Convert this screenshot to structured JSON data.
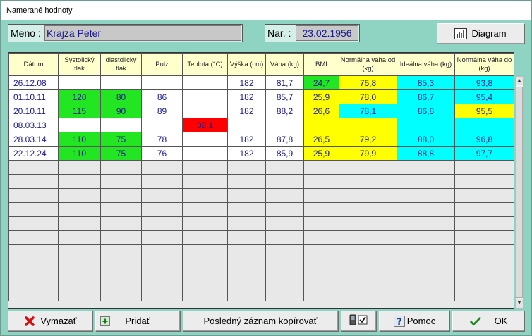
{
  "window": {
    "title": "Namerané hodnoty"
  },
  "patient": {
    "name_label": "Meno :",
    "name_value": "Krajza Peter",
    "dob_label": "Nar. :",
    "dob_value": "23.02.1956"
  },
  "toolbar": {
    "diagram_label": "Diagram"
  },
  "table": {
    "headers": [
      "Dátum",
      "Systolický tlak",
      "diastolický tlak",
      "Pulz",
      "Teplota (°C)",
      "Výška (cm)",
      "Váha (kg)",
      "BMI",
      "Normálna váha od (kg)",
      "Ideálna váha (kg)",
      "Normálna váha do (kg)"
    ],
    "rows": [
      [
        "26.12.08",
        "",
        "",
        "",
        "",
        "182",
        "81,7",
        "24,7",
        "76,8",
        "85,3",
        "93,8"
      ],
      [
        "01.10.11",
        "120",
        "80",
        "86",
        "",
        "182",
        "85,7",
        "25,9",
        "78,0",
        "86,7",
        "95,4"
      ],
      [
        "20.10.11",
        "115",
        "90",
        "89",
        "",
        "182",
        "88,2",
        "26,6",
        "78,1",
        "86,8",
        "95,5"
      ],
      [
        "08.03.13",
        "",
        "",
        "",
        "38,1",
        "",
        "",
        "",
        "",
        "",
        ""
      ],
      [
        "28.03.14",
        "110",
        "75",
        "78",
        "",
        "182",
        "87,8",
        "26,5",
        "79,2",
        "88,0",
        "96,8"
      ],
      [
        "22.12.24",
        "110",
        "75",
        "76",
        "",
        "182",
        "85,9",
        "25,9",
        "79,9",
        "88,8",
        "97,7"
      ]
    ],
    "cell_colors": [
      [
        "white",
        "white",
        "white",
        "white",
        "white",
        "white",
        "white",
        "green",
        "yellow",
        "cyan",
        "cyan"
      ],
      [
        "white",
        "green",
        "green",
        "white",
        "white",
        "white",
        "white",
        "yellow",
        "yellow",
        "cyan",
        "cyan"
      ],
      [
        "white",
        "green",
        "green",
        "white",
        "white",
        "white",
        "white",
        "yellow",
        "cyan",
        "cyan",
        "yellow"
      ],
      [
        "white",
        "white",
        "white",
        "white",
        "red",
        "white",
        "white",
        "yellow",
        "yellow",
        "cyan",
        "cyan"
      ],
      [
        "white",
        "green",
        "green",
        "white",
        "white",
        "white",
        "white",
        "yellow",
        "yellow",
        "cyan",
        "cyan"
      ],
      [
        "white",
        "green",
        "green",
        "white",
        "white",
        "white",
        "white",
        "yellow",
        "yellow",
        "cyan",
        "cyan"
      ]
    ],
    "empty_rows": 10
  },
  "colors": {
    "green": "#22e622",
    "yellow": "#ffff00",
    "cyan": "#00ffff",
    "red": "#ff0000",
    "white": "#ffffff"
  },
  "buttons": {
    "delete_label": "Vymazať",
    "add_label": "Pridať",
    "copy_label": "Posledný záznam kopírovať",
    "help_label": "Pomoc",
    "ok_label": "OK"
  },
  "icons": {
    "diagram": "bar-chart-icon",
    "delete": "red-x-icon",
    "add": "plus-icon",
    "device": "device-check-icon",
    "help": "question-icon",
    "ok": "checkmark-icon"
  }
}
